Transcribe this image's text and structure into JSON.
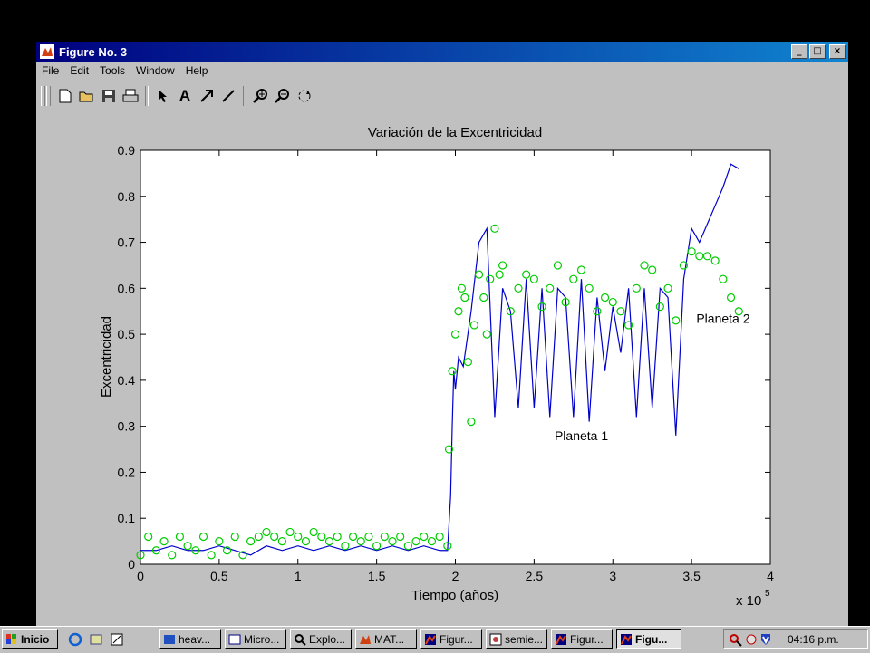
{
  "window": {
    "title": "Figure No. 3",
    "buttons": {
      "minimize": "_",
      "maximize": "□",
      "close": "×"
    }
  },
  "menu": [
    "File",
    "Edit",
    "Tools",
    "Window",
    "Help"
  ],
  "toolbar": {
    "icons": [
      "new-file-icon",
      "open-folder-icon",
      "save-icon",
      "print-icon",
      "pointer-icon",
      "text-icon",
      "arrow-icon",
      "line-icon",
      "zoom-in-icon",
      "zoom-out-icon",
      "rotate-icon"
    ],
    "text_tool_label": "A"
  },
  "chart_data": {
    "type": "scatter",
    "title": "Variación de la Excentricidad",
    "xlabel": "Tiempo (años)",
    "ylabel": "Excentricidad",
    "x_multiplier": "x 10",
    "x_multiplier_exponent": "5",
    "xlim": [
      0,
      4
    ],
    "ylim": [
      0,
      0.9
    ],
    "x_ticks": [
      "0",
      "0.5",
      "1",
      "1.5",
      "2",
      "2.5",
      "3",
      "3.5",
      "4"
    ],
    "y_ticks": [
      "0",
      "0.1",
      "0.2",
      "0.3",
      "0.4",
      "0.5",
      "0.6",
      "0.7",
      "0.8",
      "0.9"
    ],
    "grid": false,
    "annotations": [
      {
        "text": "Planeta 1",
        "x": 2.63,
        "y": 0.27
      },
      {
        "text": "Planeta 2",
        "x": 3.53,
        "y": 0.525
      }
    ],
    "series": [
      {
        "marker": "line",
        "color": "#0000cc",
        "x": [
          0.0,
          0.1,
          0.2,
          0.3,
          0.4,
          0.5,
          0.6,
          0.7,
          0.8,
          0.9,
          1.0,
          1.1,
          1.2,
          1.3,
          1.4,
          1.5,
          1.6,
          1.7,
          1.8,
          1.9,
          1.95,
          1.97,
          1.98,
          1.99,
          2.0,
          2.02,
          2.05,
          2.1,
          2.15,
          2.2,
          2.25,
          2.3,
          2.35,
          2.4,
          2.45,
          2.5,
          2.55,
          2.6,
          2.65,
          2.7,
          2.75,
          2.8,
          2.85,
          2.9,
          2.95,
          3.0,
          3.05,
          3.1,
          3.15,
          3.2,
          3.25,
          3.3,
          3.35,
          3.4,
          3.45,
          3.5,
          3.55,
          3.6,
          3.65,
          3.7,
          3.75,
          3.8
        ],
        "y": [
          0.03,
          0.03,
          0.04,
          0.03,
          0.03,
          0.04,
          0.03,
          0.02,
          0.04,
          0.03,
          0.04,
          0.03,
          0.04,
          0.03,
          0.04,
          0.03,
          0.04,
          0.03,
          0.04,
          0.03,
          0.03,
          0.15,
          0.3,
          0.42,
          0.38,
          0.45,
          0.43,
          0.55,
          0.7,
          0.73,
          0.32,
          0.6,
          0.55,
          0.34,
          0.62,
          0.34,
          0.6,
          0.32,
          0.6,
          0.58,
          0.32,
          0.62,
          0.31,
          0.58,
          0.42,
          0.56,
          0.46,
          0.6,
          0.32,
          0.6,
          0.34,
          0.6,
          0.58,
          0.28,
          0.62,
          0.73,
          0.7,
          0.74,
          0.78,
          0.82,
          0.87,
          0.86
        ]
      },
      {
        "marker": "circle",
        "color": "#00cc00",
        "x": [
          0.0,
          0.05,
          0.1,
          0.15,
          0.2,
          0.25,
          0.3,
          0.35,
          0.4,
          0.45,
          0.5,
          0.55,
          0.6,
          0.65,
          0.7,
          0.75,
          0.8,
          0.85,
          0.9,
          0.95,
          1.0,
          1.05,
          1.1,
          1.15,
          1.2,
          1.25,
          1.3,
          1.35,
          1.4,
          1.45,
          1.5,
          1.55,
          1.6,
          1.65,
          1.7,
          1.75,
          1.8,
          1.85,
          1.9,
          1.95,
          1.96,
          1.98,
          2.0,
          2.02,
          2.04,
          2.06,
          2.08,
          2.1,
          2.12,
          2.15,
          2.18,
          2.2,
          2.22,
          2.25,
          2.28,
          2.3,
          2.35,
          2.4,
          2.45,
          2.5,
          2.55,
          2.6,
          2.65,
          2.7,
          2.75,
          2.8,
          2.85,
          2.9,
          2.95,
          3.0,
          3.05,
          3.1,
          3.15,
          3.2,
          3.25,
          3.3,
          3.35,
          3.4,
          3.45,
          3.5,
          3.55,
          3.6,
          3.65,
          3.7,
          3.75,
          3.8
        ],
        "y": [
          0.02,
          0.06,
          0.03,
          0.05,
          0.02,
          0.06,
          0.04,
          0.03,
          0.06,
          0.02,
          0.05,
          0.03,
          0.06,
          0.02,
          0.05,
          0.06,
          0.07,
          0.06,
          0.05,
          0.07,
          0.06,
          0.05,
          0.07,
          0.06,
          0.05,
          0.06,
          0.04,
          0.06,
          0.05,
          0.06,
          0.04,
          0.06,
          0.05,
          0.06,
          0.04,
          0.05,
          0.06,
          0.05,
          0.06,
          0.04,
          0.25,
          0.42,
          0.5,
          0.55,
          0.6,
          0.58,
          0.44,
          0.31,
          0.52,
          0.63,
          0.58,
          0.5,
          0.62,
          0.73,
          0.63,
          0.65,
          0.55,
          0.6,
          0.63,
          0.62,
          0.56,
          0.6,
          0.65,
          0.57,
          0.62,
          0.64,
          0.6,
          0.55,
          0.58,
          0.57,
          0.55,
          0.52,
          0.6,
          0.65,
          0.64,
          0.56,
          0.6,
          0.53,
          0.65,
          0.68,
          0.67,
          0.67,
          0.66,
          0.62,
          0.58,
          0.55
        ]
      }
    ]
  },
  "taskbar": {
    "start_label": "Inicio",
    "buttons": [
      {
        "label": "heav..."
      },
      {
        "label": "Micro..."
      },
      {
        "label": "Explo..."
      },
      {
        "label": "MAT..."
      },
      {
        "label": "Figur..."
      },
      {
        "label": "semie..."
      },
      {
        "label": "Figur..."
      },
      {
        "label": "Figu...",
        "active": true
      }
    ],
    "clock": "04:16 p.m."
  },
  "colors": {
    "titlebar": "#00007f",
    "planeta1": "#0000cc",
    "planeta2": "#00cc00",
    "desktop": "#000000"
  }
}
